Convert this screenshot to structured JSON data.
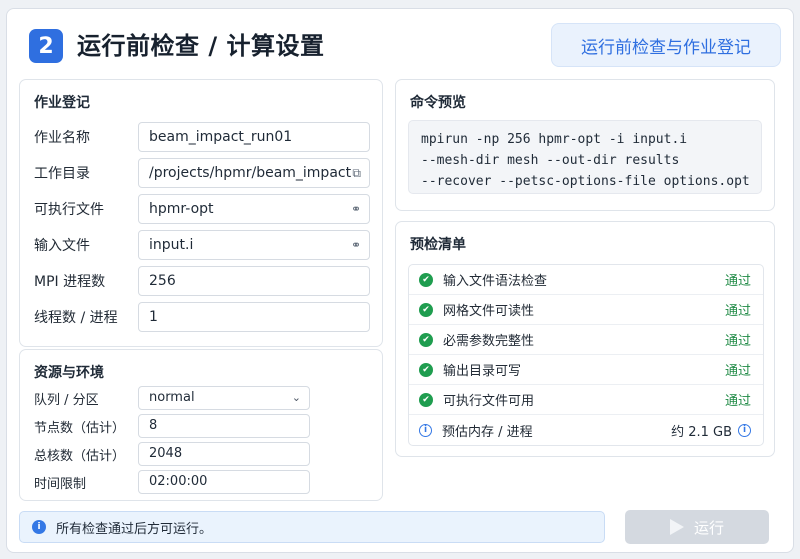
{
  "header": {
    "step_number": "2",
    "title": "运行前检查 / 计算设置",
    "tab_label": "运行前检查与作业登记"
  },
  "job": {
    "title": "作业登记",
    "fields": [
      {
        "label": "作业名称",
        "value": "beam_impact_run01",
        "icon": ""
      },
      {
        "label": "工作目录",
        "value": "/projects/hpmr/beam_impact",
        "icon": "folder-open-icon"
      },
      {
        "label": "可执行文件",
        "value": "hpmr-opt",
        "icon": "link-icon"
      },
      {
        "label": "输入文件",
        "value": "input.i",
        "icon": "link-icon"
      },
      {
        "label": "MPI 进程数",
        "value": "256",
        "icon": ""
      },
      {
        "label": "线程数 / 进程",
        "value": "1",
        "icon": ""
      }
    ]
  },
  "resources": {
    "title": "资源与环境",
    "queue_label": "队列 / 分区",
    "queue_value": "normal",
    "nodes_label": "节点数（估计）",
    "nodes_value": "8",
    "cores_label": "总核数（估计）",
    "cores_value": "2048",
    "time_label": "时间限制",
    "time_value": "02:00:00"
  },
  "command": {
    "title": "命令预览",
    "lines": [
      "mpirun -np 256 hpmr-opt -i input.i",
      "--mesh-dir mesh --out-dir results",
      "--recover --petsc-options-file options.opt"
    ]
  },
  "checks": {
    "title": "预检清单",
    "items": [
      {
        "label": "输入文件语法检查",
        "status": "通过"
      },
      {
        "label": "网格文件可读性",
        "status": "通过"
      },
      {
        "label": "必需参数完整性",
        "status": "通过"
      },
      {
        "label": "输出目录可写",
        "status": "通过"
      },
      {
        "label": "可执行文件可用",
        "status": "通过"
      }
    ],
    "estimate_label": "预估内存 / 进程",
    "estimate_value": "约 2.1 GB"
  },
  "footer": {
    "notice": "所有检查通过后方可运行。",
    "run_label": "运行"
  },
  "colors": {
    "accent": "#2f6fe0",
    "pass": "#1f8a45",
    "disabled": "#d4d9e0"
  }
}
